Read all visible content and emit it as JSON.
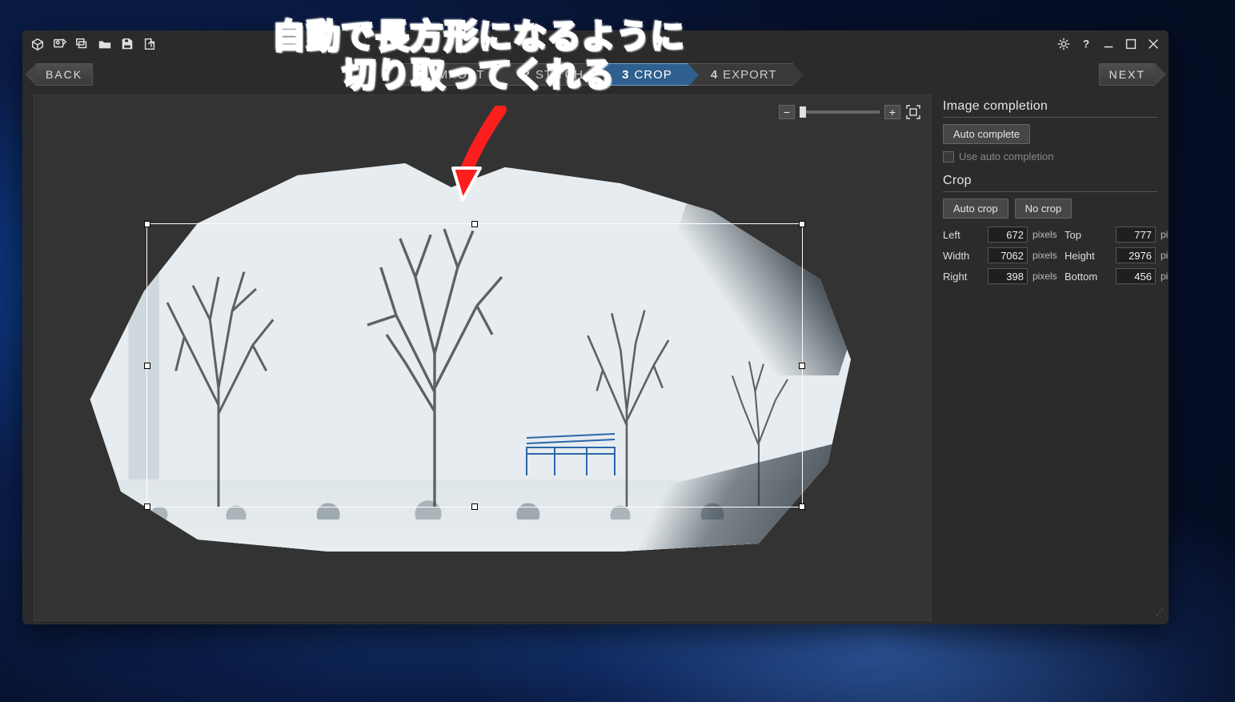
{
  "titlebar": {
    "icons": {
      "package": "package-icon",
      "import1": "import-images-icon",
      "import2": "import-folder-icon",
      "folder": "open-icon",
      "save": "save-icon",
      "export": "export-icon",
      "settings": "settings-icon",
      "help": "help-icon",
      "minimize": "minimize-icon",
      "maximize": "maximize-icon",
      "close": "close-icon"
    }
  },
  "nav": {
    "back": "BACK",
    "next": "NEXT",
    "steps": [
      {
        "num": "1",
        "label": "IMPORT",
        "active": false
      },
      {
        "num": "2",
        "label": "STITCH",
        "active": false
      },
      {
        "num": "3",
        "label": "CROP",
        "active": true
      },
      {
        "num": "4",
        "label": "EXPORT",
        "active": false
      }
    ]
  },
  "zoom": {
    "minus": "−",
    "plus": "+"
  },
  "panel": {
    "image_completion": {
      "heading": "Image completion",
      "auto_complete": "Auto complete",
      "use_auto_label": "Use auto completion",
      "use_auto_checked": false
    },
    "crop": {
      "heading": "Crop",
      "auto_crop": "Auto crop",
      "no_crop": "No crop",
      "fields": {
        "left_label": "Left",
        "left": "672",
        "top_label": "Top",
        "top": "777",
        "width_label": "Width",
        "width": "7062",
        "height_label": "Height",
        "height": "2976",
        "right_label": "Right",
        "right": "398",
        "bottom_label": "Bottom",
        "bottom": "456",
        "unit": "pixels"
      }
    }
  },
  "annotation": {
    "line1": "自動で長方形になるように",
    "line2": "切り取ってくれる"
  }
}
